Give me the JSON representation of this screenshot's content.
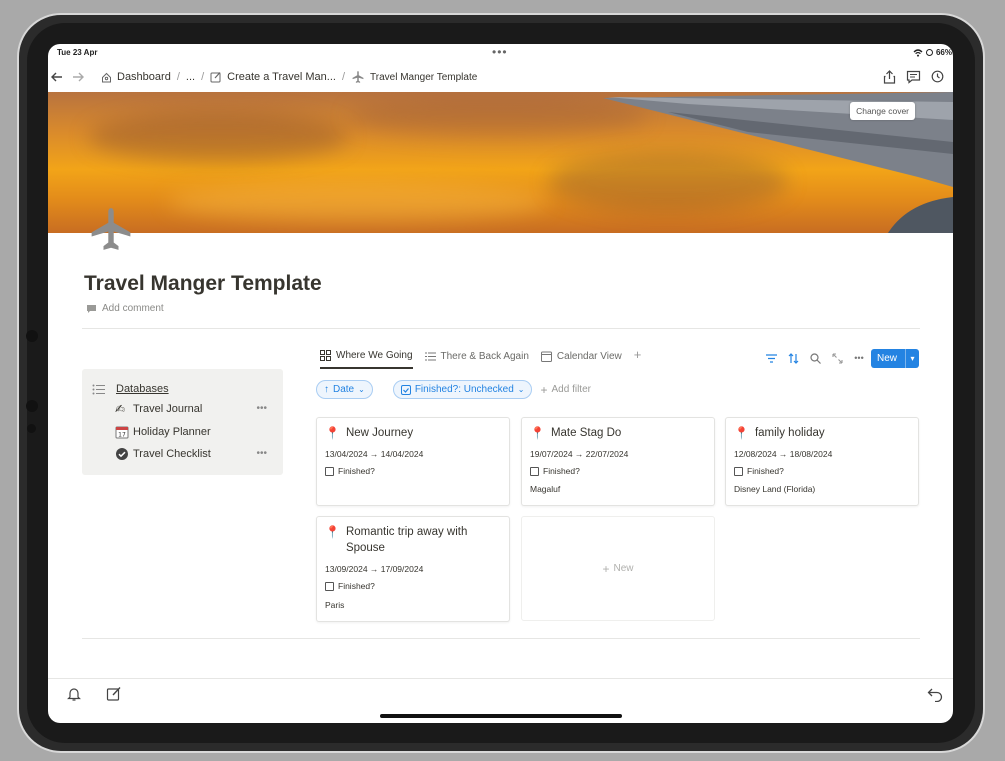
{
  "status_bar": {
    "time": "Tue 23 Apr",
    "battery": "66%"
  },
  "breadcrumbs": [
    {
      "label": "Dashboard",
      "icon": "home-icon"
    },
    {
      "label": "...",
      "icon": ""
    },
    {
      "label": "Create a Travel Man...",
      "icon": "edit-icon"
    },
    {
      "label": "Travel Manger Template",
      "icon": "plane-icon"
    }
  ],
  "cover": {
    "change_cover_label": "Change cover"
  },
  "page": {
    "title": "Travel Manger Template",
    "add_comment_label": "Add comment"
  },
  "databases_panel": {
    "title": "Databases",
    "items": [
      {
        "label": "Travel Journal",
        "icon": "writing-hand-icon"
      },
      {
        "label": "Holiday Planner",
        "icon": "calendar-icon"
      },
      {
        "label": "Travel Checklist",
        "icon": "check-circle-icon"
      }
    ]
  },
  "views": {
    "tabs": [
      {
        "label": "Where We Going",
        "icon": "gallery-icon",
        "active": true
      },
      {
        "label": "There & Back Again",
        "icon": "list-icon",
        "active": false
      },
      {
        "label": "Calendar View",
        "icon": "calendar-icon",
        "active": false
      }
    ],
    "new_button_label": "New"
  },
  "filters": {
    "sort_chip": "Date",
    "filter_chip": "Finished?: Unchecked",
    "add_filter_label": "Add filter"
  },
  "cards": [
    {
      "title": "New Journey",
      "dates": "13/04/2024 → 14/04/2024",
      "checkbox_label": "Finished?",
      "location": ""
    },
    {
      "title": "Mate Stag Do",
      "dates": "19/07/2024 → 22/07/2024",
      "checkbox_label": "Finished?",
      "location": "Magaluf"
    },
    {
      "title": "family holiday",
      "dates": "12/08/2024 → 18/08/2024",
      "checkbox_label": "Finished?",
      "location": "Disney Land (Florida)"
    },
    {
      "title": "Romantic trip away with Spouse",
      "dates": "13/09/2024 → 17/09/2024",
      "checkbox_label": "Finished?",
      "location": "Paris"
    }
  ],
  "new_card_label": "New",
  "colors": {
    "accent": "#2383e2",
    "pin": "#d63b3b",
    "panel_bg": "#f1f1ef"
  }
}
